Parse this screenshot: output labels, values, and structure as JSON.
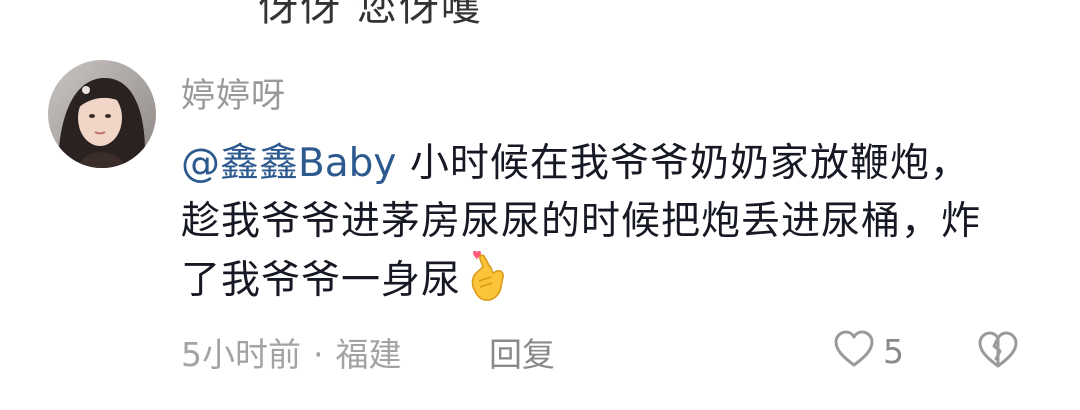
{
  "previous_comment_fragment": "伢伢 您伢嚄",
  "comment": {
    "username": "婷婷呀",
    "mention": "@鑫鑫Baby",
    "text": " 小时候在我爷爷奶奶家放鞭炮，趁我爷爷进茅房尿尿的时候把炮丢进尿桶，炸了我爷爷一身尿",
    "emoji_icon": "finger-heart-emoji",
    "time": "5小时前",
    "separator": "·",
    "location": "福建",
    "reply_label": "回复",
    "like_count": "5",
    "like_icon": "heart-outline-icon",
    "dislike_icon": "broken-heart-icon"
  },
  "colors": {
    "mention": "#2d5a8e",
    "text": "#161823",
    "meta": "#a3a3a3",
    "username": "#9a9a9a"
  }
}
